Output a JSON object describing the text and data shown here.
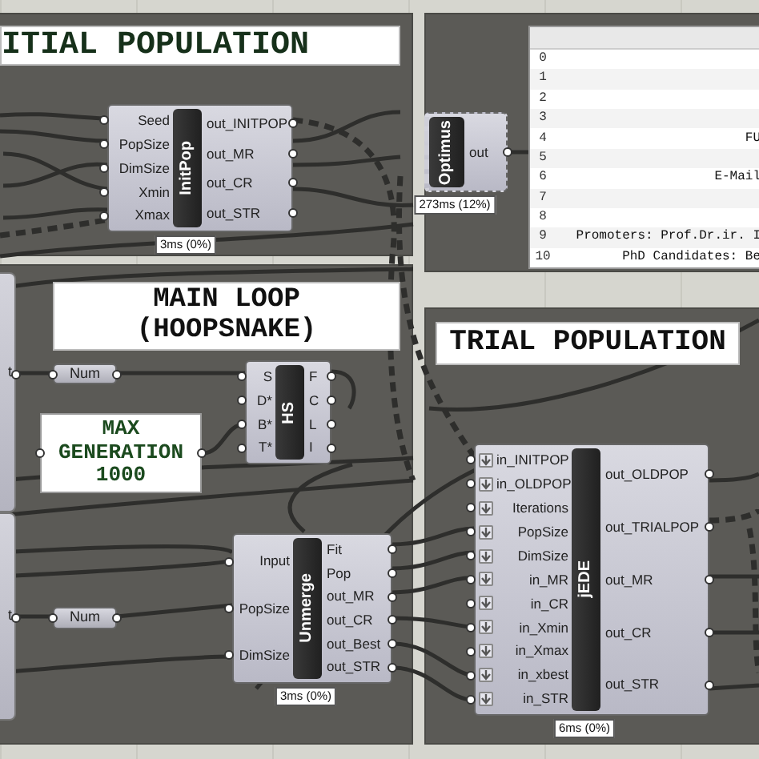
{
  "scribbles": [
    {
      "lines": [
        "ITIAL POPULATION"
      ]
    },
    {
      "lines": [
        "MAIN LOOP",
        "(HOOPSNAKE)"
      ]
    },
    {
      "lines": [
        "TRIAL POPULATION"
      ]
    }
  ],
  "partial_components": [
    {
      "output": "t"
    },
    {
      "output": "t"
    }
  ],
  "number_params": [
    {
      "label": "Num"
    },
    {
      "label": "Num"
    }
  ],
  "goal_panel": {
    "lines": [
      "MAX",
      "GENERATION",
      "1000"
    ]
  },
  "text_panel": {
    "rows": [
      {
        "index": "0"
      },
      {
        "index": "1"
      },
      {
        "index": "2"
      },
      {
        "index": "3"
      },
      {
        "index": "4",
        "text": "FU"
      },
      {
        "index": "5"
      },
      {
        "index": "6",
        "text": "E-Mail"
      },
      {
        "index": "7"
      },
      {
        "index": "8"
      },
      {
        "index": "9",
        "text": "Promoters: Prof.Dr.ir. I"
      },
      {
        "index": "10",
        "text": "PhD Candidates: Be"
      }
    ]
  },
  "components": [
    {
      "kind": "standard",
      "name": "InitPop",
      "inputs": [
        "Seed",
        "PopSize",
        "DimSize",
        "Xmin",
        "Xmax"
      ],
      "outputs": [
        "out_INITPOP",
        "out_MR",
        "out_CR",
        "out_STR"
      ],
      "timer": "3ms (0%)"
    },
    {
      "kind": "script",
      "name": "Optimus",
      "outputs": [
        "out"
      ],
      "timer": "273ms (12%)"
    },
    {
      "kind": "standard",
      "name": "HS",
      "inputs": [
        "S",
        "D*",
        "B*",
        "T*"
      ],
      "outputs": [
        "F",
        "C",
        "L",
        "I"
      ]
    },
    {
      "kind": "standard",
      "name": "Unmerge",
      "inputs": [
        "Input",
        "PopSize",
        "DimSize"
      ],
      "outputs": [
        "Fit",
        "Pop",
        "out_MR",
        "out_CR",
        "out_Best",
        "out_STR"
      ],
      "timer": "3ms (0%)"
    },
    {
      "kind": "python",
      "name": "jEDE",
      "inputs": [
        "in_INITPOP",
        "in_OLDPOP",
        "Iterations",
        "PopSize",
        "DimSize",
        "in_MR",
        "in_CR",
        "in_Xmin",
        "in_Xmax",
        "in_xbest",
        "in_STR"
      ],
      "outputs": [
        "out_OLDPOP",
        "out_TRIALPOP",
        "out_MR",
        "out_CR",
        "out_STR"
      ],
      "timer": "6ms (0%)"
    }
  ]
}
